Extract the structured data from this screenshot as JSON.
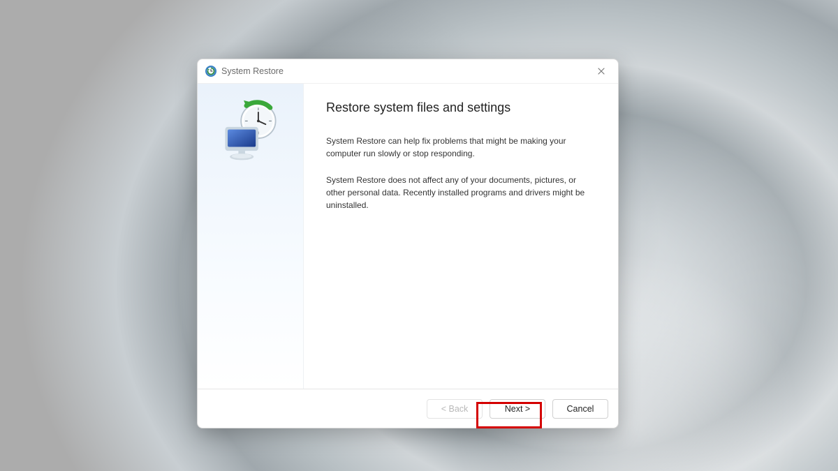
{
  "window": {
    "title": "System Restore"
  },
  "content": {
    "heading": "Restore system files and settings",
    "paragraph1": "System Restore can help fix problems that might be making your computer run slowly or stop responding.",
    "paragraph2": "System Restore does not affect any of your documents, pictures, or other personal data. Recently installed programs and drivers might be uninstalled."
  },
  "buttons": {
    "back": "< Back",
    "next": "Next >",
    "cancel": "Cancel"
  }
}
